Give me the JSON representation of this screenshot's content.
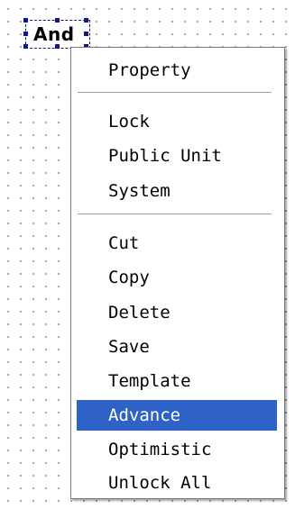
{
  "canvas": {
    "unit_label": "And"
  },
  "context_menu": {
    "items": [
      {
        "label": "Property"
      },
      {
        "label": "Lock"
      },
      {
        "label": "Public Unit"
      },
      {
        "label": "System"
      },
      {
        "label": "Cut"
      },
      {
        "label": "Copy"
      },
      {
        "label": "Delete"
      },
      {
        "label": "Save"
      },
      {
        "label": "Template"
      },
      {
        "label": "Advance"
      },
      {
        "label": "Optimistic"
      },
      {
        "label": "Unlock All"
      }
    ],
    "selected_label": "Advance"
  },
  "colors": {
    "highlight": "#2f62c6",
    "handle": "#0a1a8c"
  }
}
